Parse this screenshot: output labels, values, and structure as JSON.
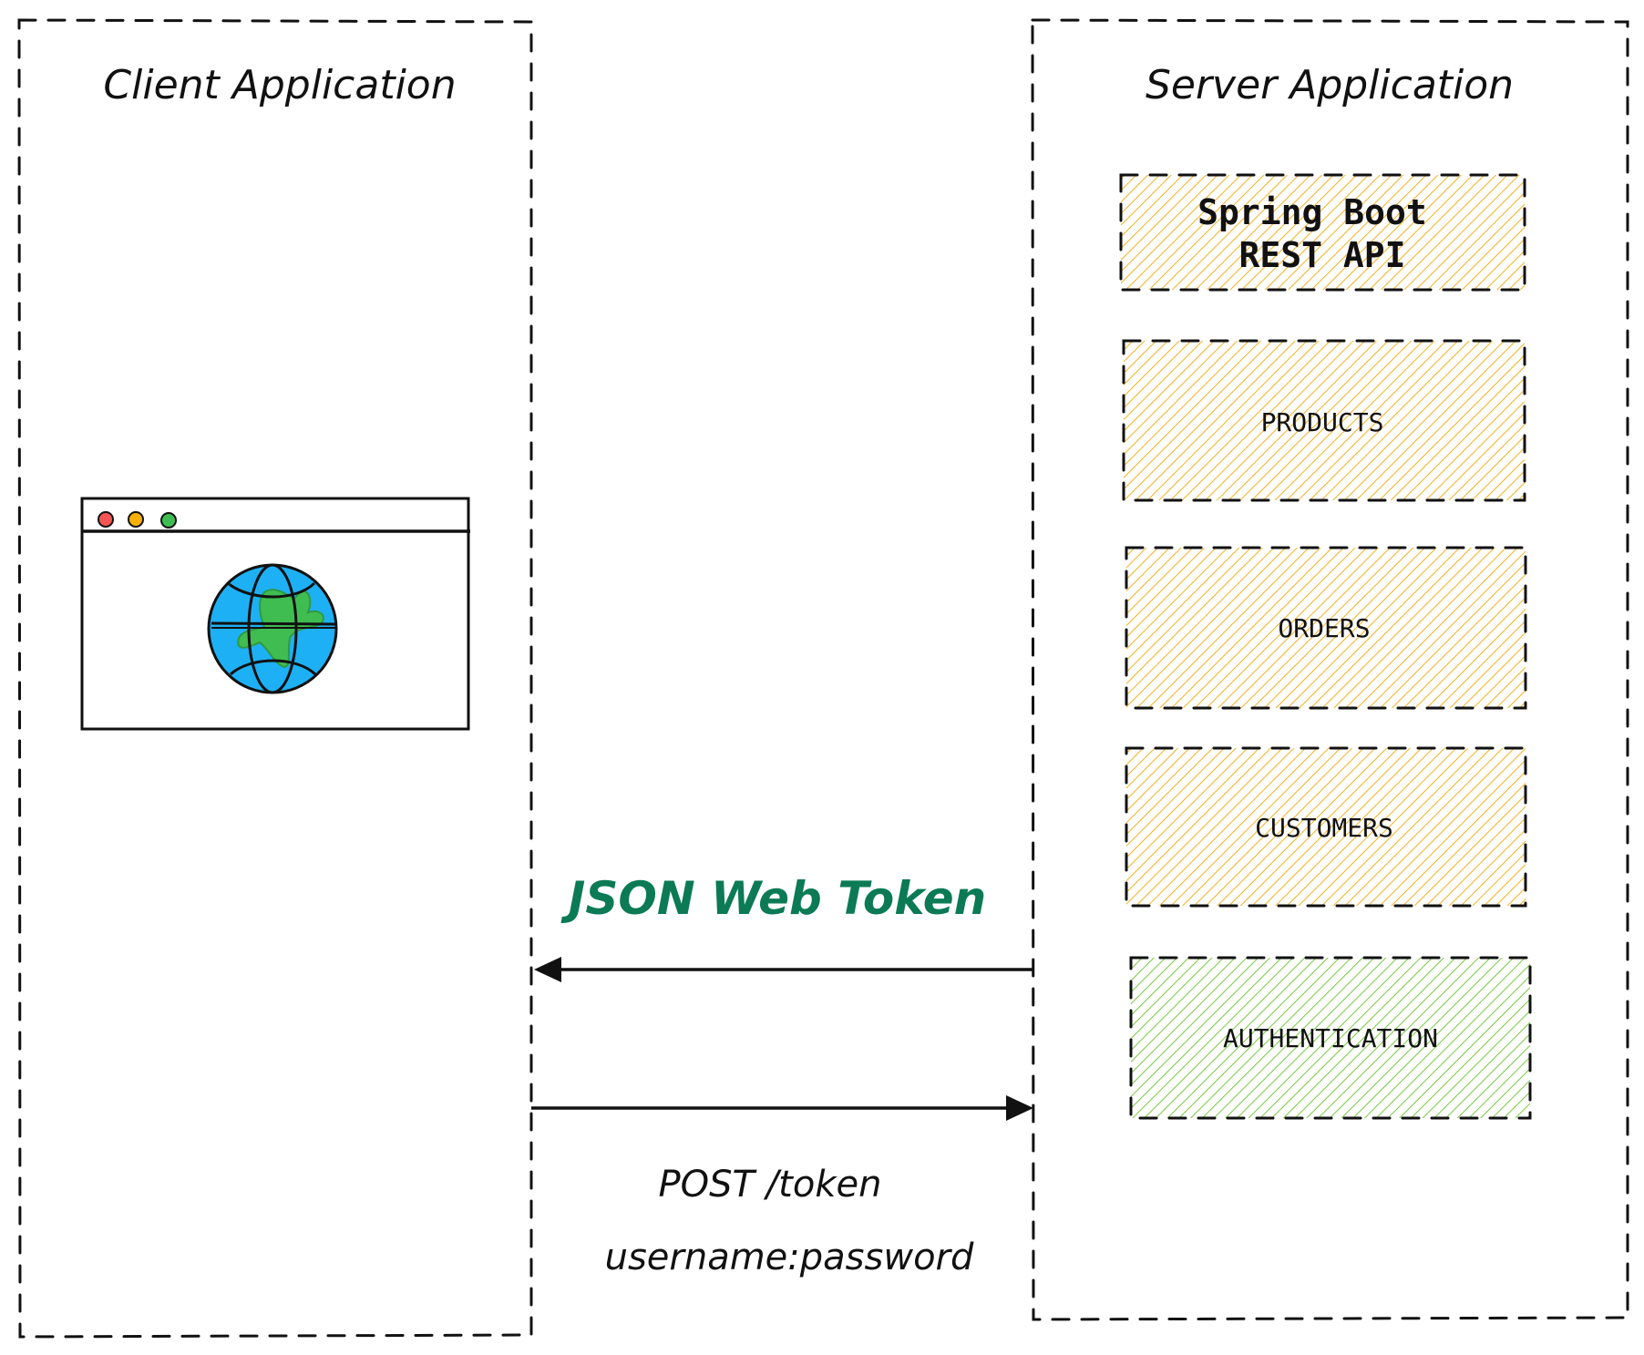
{
  "client": {
    "title": "Client Application",
    "browser_icon": "browser-window-icon",
    "globe_icon": "globe-icon",
    "traffic_lights": [
      "#f55454",
      "#f9b005",
      "#3fbd51"
    ]
  },
  "server": {
    "title": "Server Application",
    "modules": [
      {
        "label_line1": "Spring Boot",
        "label_line2": "REST API",
        "color": "#f5b120",
        "kind": "header"
      },
      {
        "label_line1": "PRODUCTS",
        "color": "#f5b120",
        "kind": "module"
      },
      {
        "label_line1": "ORDERS",
        "color": "#f5b120",
        "kind": "module"
      },
      {
        "label_line1": "CUSTOMERS",
        "color": "#f5b120",
        "kind": "module"
      },
      {
        "label_line1": "AUTHENTICATION",
        "color": "#7ac943",
        "kind": "module"
      }
    ]
  },
  "flows": {
    "response": {
      "label": "JSON Web Token",
      "color": "#0b7a55",
      "direction": "server-to-client"
    },
    "request": {
      "label_line1": "POST /token",
      "label_line2": "username:password",
      "direction": "client-to-server"
    }
  },
  "colors": {
    "stroke": "#111111",
    "globe_ocean": "#1eb0f5",
    "globe_land": "#3fbd51"
  }
}
